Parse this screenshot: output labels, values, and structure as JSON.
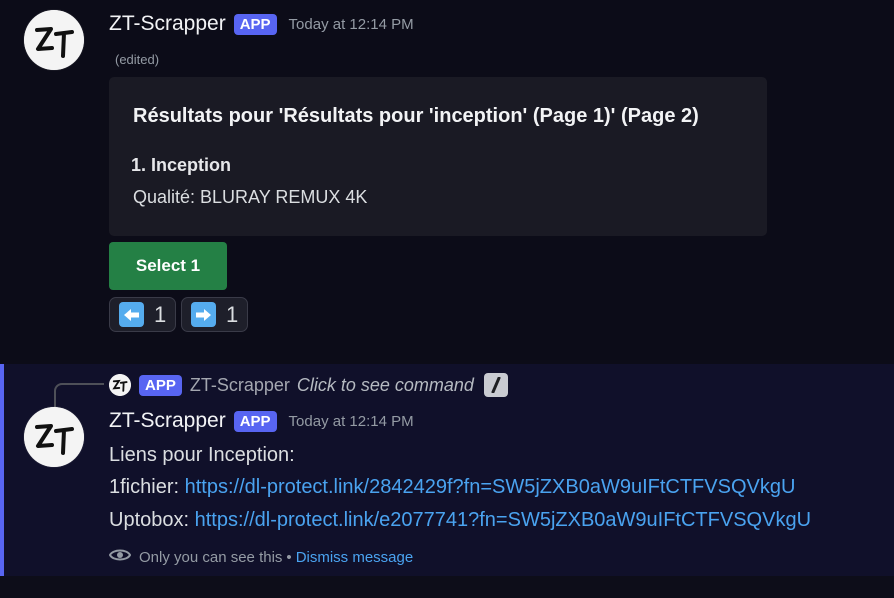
{
  "message1": {
    "username": "ZT-Scrapper",
    "badge": "APP",
    "timestamp": "Today at 12:14 PM",
    "edited": "(edited)",
    "embed": {
      "title": "Résultats pour 'Résultats pour 'inception' (Page 1)' (Page 2)",
      "field_name": "1. Inception",
      "field_value": "Qualité: BLURAY REMUX 4K"
    },
    "select_button": "Select 1",
    "prev_count": "1",
    "next_count": "1"
  },
  "message2": {
    "reply": {
      "badge": "APP",
      "username": "ZT-Scrapper",
      "command_text": "Click to see command"
    },
    "username": "ZT-Scrapper",
    "badge": "APP",
    "timestamp": "Today at 12:14 PM",
    "line1": "Liens pour Inception:",
    "link1_label": "1fichier:",
    "link1_url": "https://dl-protect.link/2842429f?fn=SW5jZXB0aW9uIFtCTFVSQVkgU",
    "link2_label": "Uptobox:",
    "link2_url": "https://dl-protect.link/e2077741?fn=SW5jZXB0aW9uIFtCTFVSQVkgU",
    "ephemeral_note": "Only you can see this",
    "separator": "•",
    "dismiss": "Dismiss message"
  },
  "colors": {
    "accent": "#5865f2",
    "success_button": "#248045",
    "link": "#4aa3f0",
    "arrow_emoji": "#55acee"
  },
  "icons": [
    "avatar-zt-logo",
    "arrow-left-emoji",
    "arrow-right-emoji",
    "slash-command-icon",
    "eye-icon"
  ]
}
